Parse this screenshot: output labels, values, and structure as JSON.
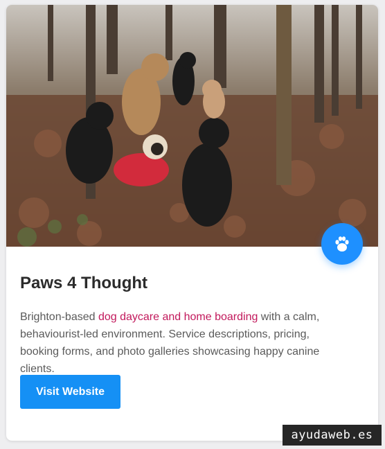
{
  "card": {
    "image_alt": "Dogs sitting in a leafy woodland",
    "title": "Paws 4 Thought",
    "description_before": "Brighton-based ",
    "description_highlight": "dog daycare and home boarding",
    "description_after": " with a calm, behaviourist-led environment. Service descriptions, pricing, booking forms, and photo galleries showcasing happy canine clients.",
    "button_label": "Visit Website",
    "badge_icon": "paw-icon"
  },
  "watermark": "ayudaweb.es",
  "colors": {
    "accent": "#1590f5",
    "highlight": "#c2185b",
    "title": "#2b2b2b",
    "text": "#5a5a5a"
  }
}
